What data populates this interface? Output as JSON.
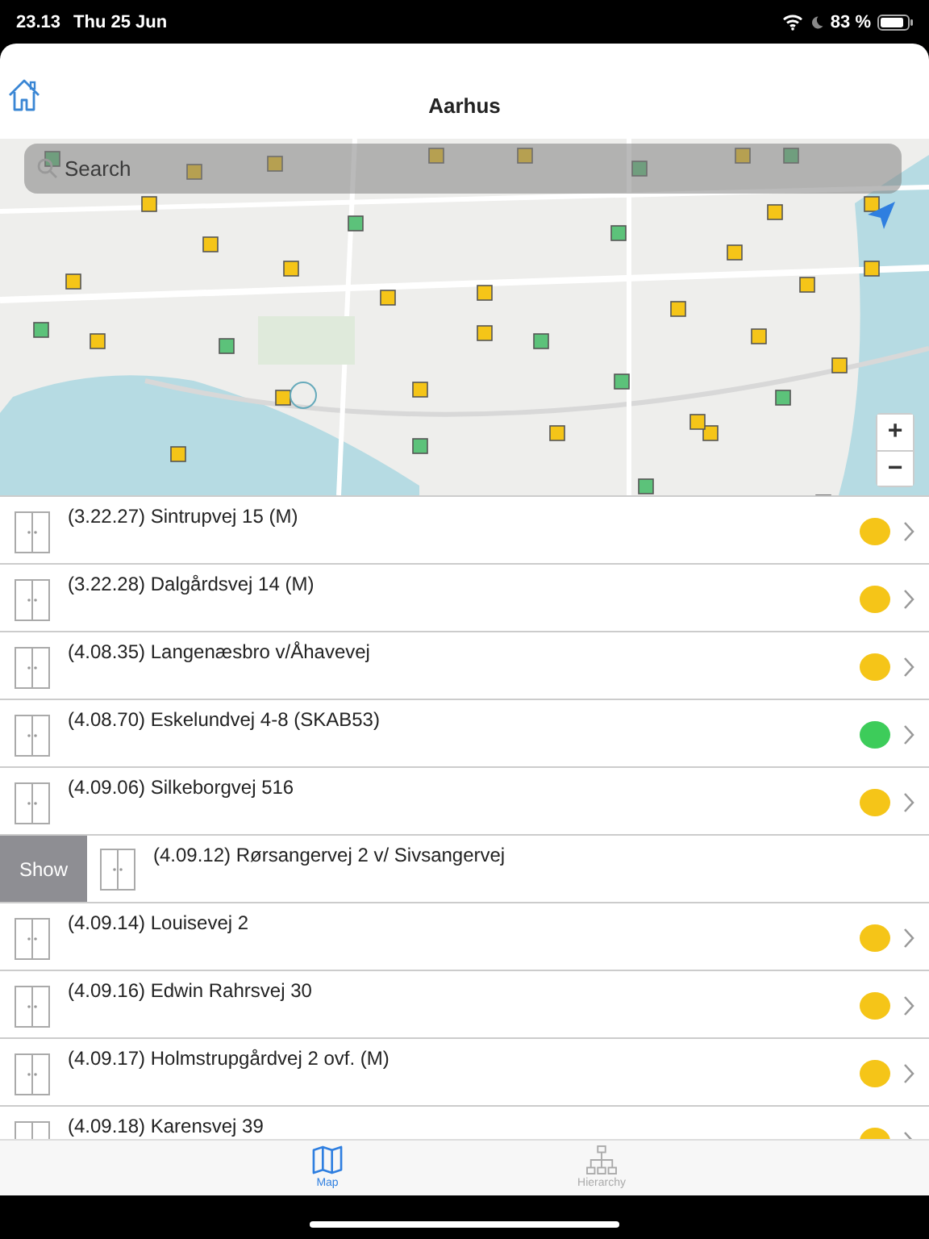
{
  "status_bar": {
    "time": "23.13",
    "date": "Thu 25 Jun",
    "battery": "83 %"
  },
  "header": {
    "title": "Aarhus"
  },
  "map": {
    "search": {
      "placeholder": "Search"
    },
    "zoom_in": "+",
    "zoom_out": "−"
  },
  "rows": [
    {
      "label": "(3.22.27) Sintrupvej 15 (M)",
      "color": "#f5c518",
      "swiped": false
    },
    {
      "label": "(3.22.28) Dalgårdsvej 14 (M)",
      "color": "#f5c518",
      "swiped": false
    },
    {
      "label": "(4.08.35) Langenæsbro v/Åhavevej",
      "color": "#f5c518",
      "swiped": false
    },
    {
      "label": "(4.08.70) Eskelundvej 4-8 (SKAB53)",
      "color": "#3dcc5a",
      "swiped": false
    },
    {
      "label": "(4.09.06) Silkeborgvej 516",
      "color": "#f5c518",
      "swiped": false
    },
    {
      "label": "(4.09.12) Rørsangervej 2 v/ Sivsangervej",
      "swiped": true,
      "action": "Show"
    },
    {
      "label": "(4.09.14) Louisevej 2",
      "color": "#f5c518",
      "swiped": false
    },
    {
      "label": "(4.09.16) Edwin Rahrsvej 30",
      "color": "#f5c518",
      "swiped": false
    },
    {
      "label": "(4.09.17) Holmstrupgårdvej 2 ovf. (M)",
      "color": "#f5c518",
      "swiped": false
    },
    {
      "label": "(4.09.18) Karensvej 39",
      "color": "#f5c518",
      "swiped": false
    }
  ],
  "tabs": [
    {
      "label": "Map",
      "kind": "map",
      "selected": true
    },
    {
      "label": "Hierarchy",
      "kind": "hierarchy",
      "selected": false
    }
  ]
}
